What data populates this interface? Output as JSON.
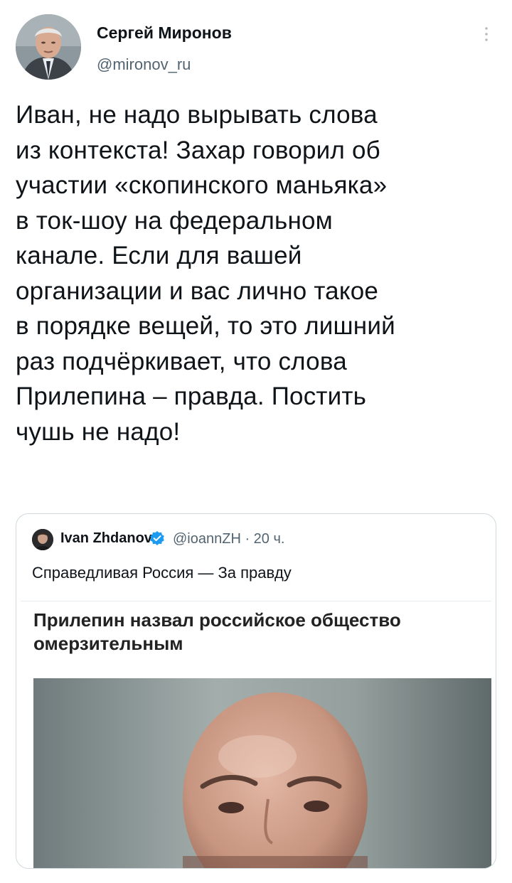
{
  "tweet": {
    "author_name": "Сергей Миронов",
    "author_handle": "@mironov_ru",
    "text_lines": [
      "Иван, не надо вырывать слова",
      "из контекста! Захар говорил об",
      "участии «скопинского маньяка»",
      "в ток-шоу на федеральном",
      "канале. Если для вашей",
      "организации и вас лично такое",
      "в порядке вещей, то это лишний",
      "раз подчёркивает, что слова",
      "Прилепина – правда. Постить",
      "чушь не надо!"
    ]
  },
  "quoted": {
    "author_name": "Ivan Zhdanov",
    "handle_time": "@ioannZH · 20 ч.",
    "text": "Справедливая Россия — За правду",
    "article_headline_lines": [
      "Прилепин назвал российское общество",
      "омерзительным"
    ]
  },
  "colors": {
    "text": "#0f1419",
    "secondary": "#536471",
    "border": "#cfd9de",
    "verified": "#1d9bf0"
  },
  "icons": {
    "more": "more-vertical-icon",
    "verified": "verified-badge-icon"
  }
}
